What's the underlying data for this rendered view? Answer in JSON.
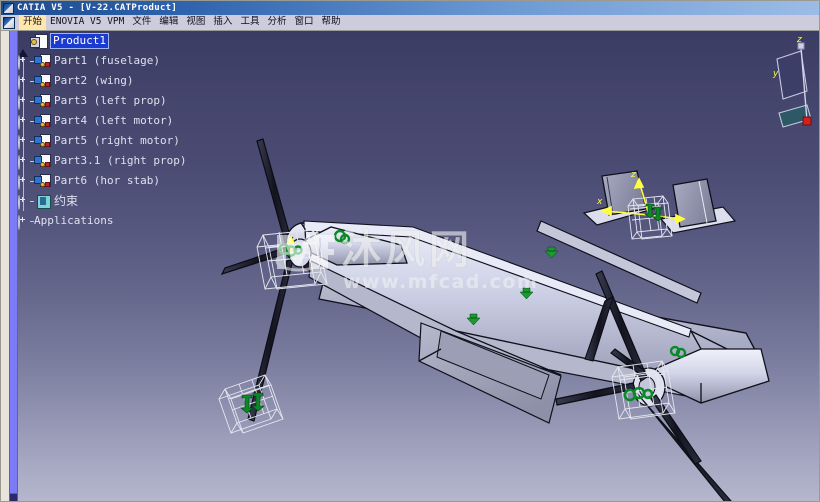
{
  "window": {
    "title": "CATIA V5 - [V-22.CATProduct]",
    "icon": "catia-logo-icon"
  },
  "menubar": {
    "icon": "catia-logo-icon",
    "items": [
      {
        "label": "开始",
        "active": true
      },
      {
        "label": "ENOVIA V5 VPM",
        "active": false
      },
      {
        "label": "文件",
        "active": false
      },
      {
        "label": "编辑",
        "active": false
      },
      {
        "label": "视图",
        "active": false
      },
      {
        "label": "插入",
        "active": false
      },
      {
        "label": "工具",
        "active": false
      },
      {
        "label": "分析",
        "active": false
      },
      {
        "label": "窗口",
        "active": false
      },
      {
        "label": "帮助",
        "active": false
      }
    ]
  },
  "spec_tree": {
    "root": {
      "label": "Product1",
      "icon": "product-icon",
      "selected": true,
      "expander": "collapse-triangle"
    },
    "nodes": [
      {
        "label": "Part1 (fuselage)",
        "icon": "part-icon",
        "expander": "plus",
        "cjk": false
      },
      {
        "label": "Part2 (wing)",
        "icon": "part-icon",
        "expander": "plus",
        "cjk": false
      },
      {
        "label": "Part3 (left prop)",
        "icon": "part-icon",
        "expander": "plus",
        "cjk": false
      },
      {
        "label": "Part4 (left motor)",
        "icon": "part-icon",
        "expander": "plus",
        "cjk": false
      },
      {
        "label": "Part5 (right motor)",
        "icon": "part-icon",
        "expander": "plus",
        "cjk": false
      },
      {
        "label": "Part3.1 (right prop)",
        "icon": "part-icon",
        "expander": "plus",
        "cjk": false
      },
      {
        "label": "Part6 (hor stab)",
        "icon": "part-icon",
        "expander": "plus",
        "cjk": false
      },
      {
        "label": "约束",
        "icon": "constraint-icon",
        "expander": "plus",
        "cjk": true
      },
      {
        "label": "Applications",
        "icon": "none",
        "expander": "plus",
        "cjk": false
      }
    ]
  },
  "viewport": {
    "name": "3d-viewport",
    "model_name": "V-22 Osprey tiltrotor assembly",
    "background_top_color": "#3a3c64",
    "background_bottom_color": "#b5b7cd",
    "part_face_color": "#c8cadf",
    "part_edge_color": "#101018",
    "constraint_symbol_color": "#0a8a26",
    "axis_arrow_color": "#ffff40",
    "wireframe_color": "#e4e4ee"
  },
  "axis_gizmo": {
    "name": "compass-axis-indicator",
    "labels": {
      "z": "z",
      "y": "y"
    },
    "label_color": "#ffff40",
    "handle_color": "#d02020"
  },
  "watermark": {
    "logo": "mf-logo",
    "text": "沐风网",
    "url": "www.mfcad.com"
  },
  "scrollbar": {
    "name": "tree-vertical-scrollbar",
    "thumb_color": "#7b7bf6"
  }
}
